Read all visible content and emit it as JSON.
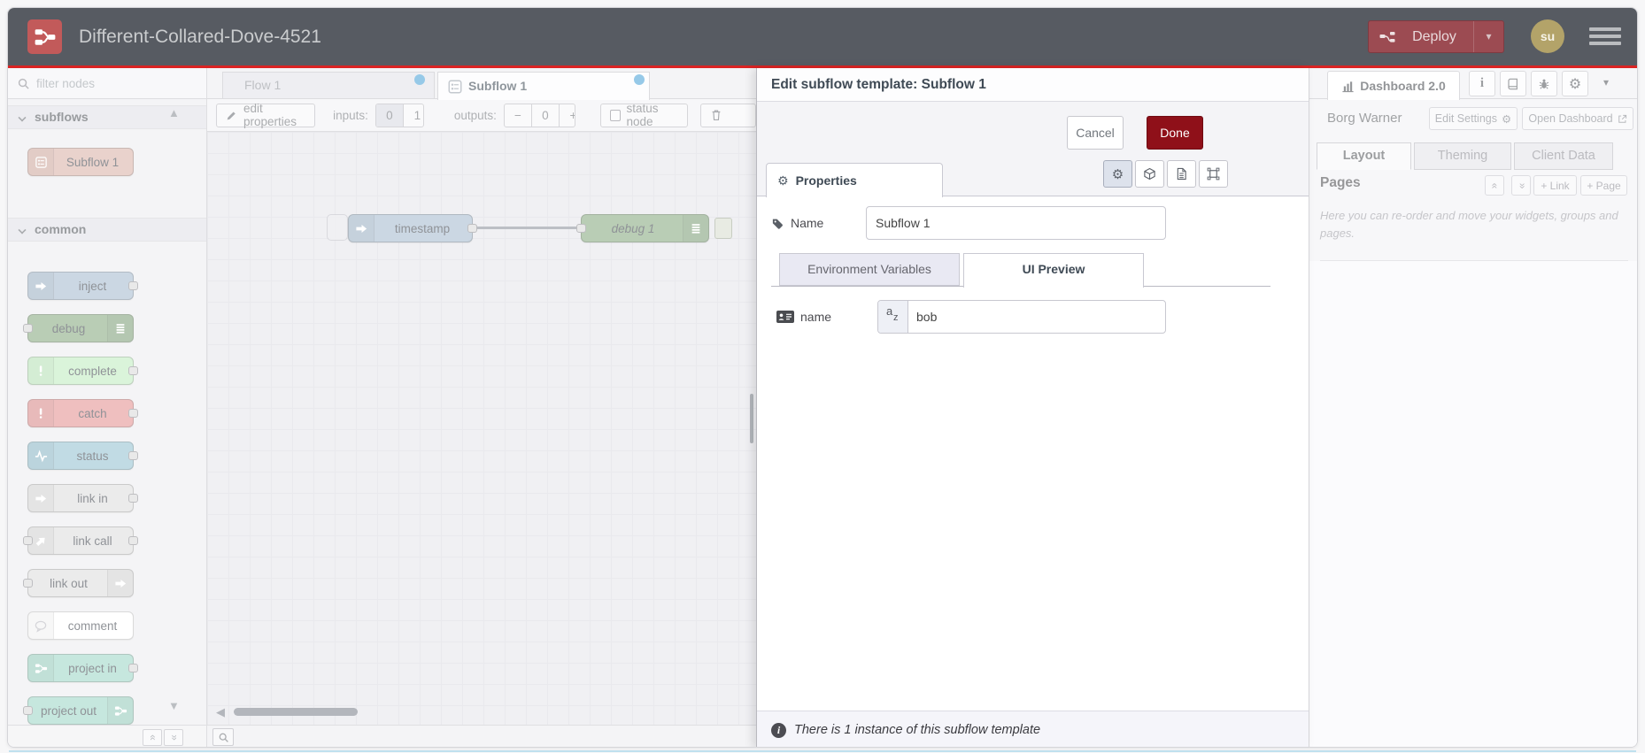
{
  "header": {
    "title": "Different-Collared-Dove-4521",
    "deploy_label": "Deploy",
    "avatar_initials": "su"
  },
  "palette": {
    "search_placeholder": "filter nodes",
    "categories": [
      {
        "label": "subflows",
        "nodes": [
          {
            "label": "Subflow 1",
            "color": "#d9b2a8",
            "icon": "subflow",
            "icon_side": "left",
            "has_input": false,
            "has_output": false
          }
        ]
      },
      {
        "label": "common",
        "nodes": [
          {
            "label": "inject",
            "color": "#a6bbcf",
            "icon": "arrow",
            "icon_side": "left",
            "has_input": false,
            "has_output": true
          },
          {
            "label": "debug",
            "color": "#87a980",
            "icon": "debuglist",
            "icon_side": "right",
            "has_input": true,
            "has_output": false
          },
          {
            "label": "complete",
            "color": "#c0edc0",
            "icon": "exclaim",
            "icon_side": "left",
            "has_input": false,
            "has_output": true
          },
          {
            "label": "catch",
            "color": "#e49191",
            "icon": "exclaim",
            "icon_side": "left",
            "has_input": false,
            "has_output": true
          },
          {
            "label": "status",
            "color": "#94c1d0",
            "icon": "pulse",
            "icon_side": "left",
            "has_input": false,
            "has_output": true
          },
          {
            "label": "link in",
            "color": "#dddddd",
            "icon": "arrow",
            "icon_side": "left",
            "has_input": false,
            "has_output": true
          },
          {
            "label": "link call",
            "color": "#dddddd",
            "icon": "linkcall",
            "icon_side": "left",
            "has_input": true,
            "has_output": true
          },
          {
            "label": "link out",
            "color": "#dddddd",
            "icon": "arrow",
            "icon_side": "right",
            "has_input": true,
            "has_output": false
          },
          {
            "label": "comment",
            "color": "#ffffff",
            "icon": "comment",
            "icon_side": "left",
            "has_input": false,
            "has_output": false
          },
          {
            "label": "project in",
            "color": "#9ed6c6",
            "icon": "nr",
            "icon_side": "left",
            "has_input": false,
            "has_output": true
          },
          {
            "label": "project out",
            "color": "#9ed6c6",
            "icon": "nr",
            "icon_side": "right",
            "has_input": true,
            "has_output": false
          }
        ]
      }
    ]
  },
  "workspace": {
    "tabs": [
      {
        "label": "Flow 1",
        "active": false
      },
      {
        "label": "Subflow 1",
        "active": true
      }
    ],
    "toolbar": {
      "edit_properties": "edit properties",
      "inputs_label": "inputs:",
      "input_options": [
        "0",
        "1"
      ],
      "selected_input": "0",
      "outputs_label": "outputs:",
      "output_count": "0",
      "status_node": "status node"
    },
    "nodes": [
      {
        "label": "timestamp",
        "color": "#a6bbcf"
      },
      {
        "label": "debug 1",
        "color": "#87a980"
      }
    ]
  },
  "tray": {
    "title": "Edit subflow template: Subflow 1",
    "cancel": "Cancel",
    "done": "Done",
    "properties_tab": "Properties",
    "name_label": "Name",
    "name_value": "Subflow 1",
    "tabs": [
      "Environment Variables",
      "UI Preview"
    ],
    "env_field": {
      "label": "name",
      "prefix_a": "a",
      "prefix_z": "z",
      "value": "bob"
    },
    "footer": "There is 1 instance of this subflow template"
  },
  "sidebar": {
    "active_tab": "Dashboard 2.0",
    "project_name": "Borg Warner",
    "edit_settings": "Edit Settings",
    "open_dashboard": "Open Dashboard",
    "tabs": [
      "Layout",
      "Theming",
      "Client Data"
    ],
    "pages_title": "Pages",
    "link_button": "+ Link",
    "page_button": "+ Page",
    "help_text": "Here you can re-order and move your widgets, groups and pages."
  },
  "icons": {
    "caret_down": "▾",
    "scroll_up": "▲",
    "scroll_down": "▼",
    "scroll_left": "◀",
    "chevrons": "«",
    "gear": "⚙",
    "minus": "−",
    "plus": "+"
  },
  "colors": {
    "header_bg": "#575b62",
    "accent_red": "#da2323",
    "deploy_bg": "#9c4b52",
    "done_bg": "#8f1019",
    "unsaved_dot": "#4aa3d8",
    "avatar_bg": "#b3a369"
  }
}
